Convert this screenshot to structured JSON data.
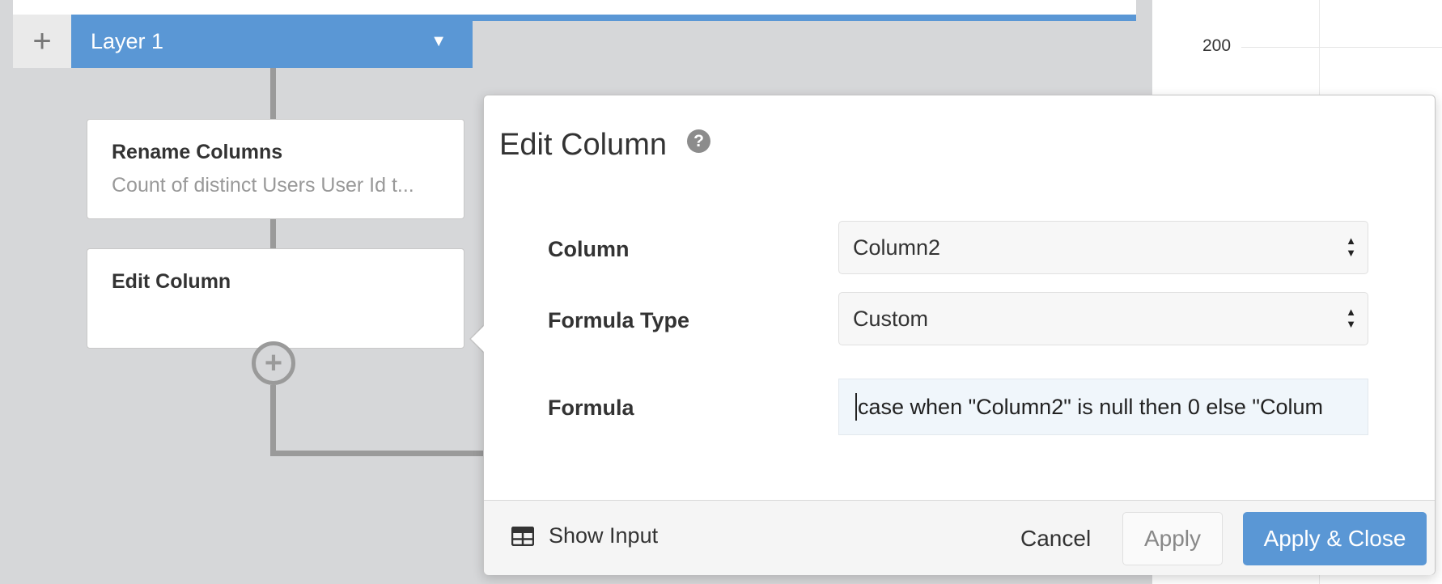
{
  "layer": {
    "add_symbol": "+",
    "name": "Layer 1",
    "caret": "▼"
  },
  "chart": {
    "tick_label": "200"
  },
  "steps": [
    {
      "title": "Rename Columns",
      "subtitle": "Count of distinct Users User Id t..."
    },
    {
      "title": "Edit Column",
      "subtitle": ""
    }
  ],
  "add_step_symbol": "+",
  "edit_column": {
    "title": "Edit Column",
    "help_symbol": "?",
    "fields": {
      "column": {
        "label": "Column",
        "value": "Column2"
      },
      "formula_type": {
        "label": "Formula Type",
        "value": "Custom"
      },
      "formula": {
        "label": "Formula",
        "value": "case when \"Column2\" is null then 0 else \"Colum"
      }
    },
    "footer": {
      "show_input_label": "Show Input",
      "cancel_label": "Cancel",
      "apply_label": "Apply",
      "apply_close_label": "Apply & Close"
    }
  },
  "colors": {
    "accent": "#5a97d5",
    "background": "#d6d7d9",
    "connector": "#9a9a9a"
  },
  "icons": [
    "plus-icon",
    "caret-down-icon",
    "help-icon",
    "table-icon",
    "select-arrows-icon",
    "add-circle-icon"
  ]
}
